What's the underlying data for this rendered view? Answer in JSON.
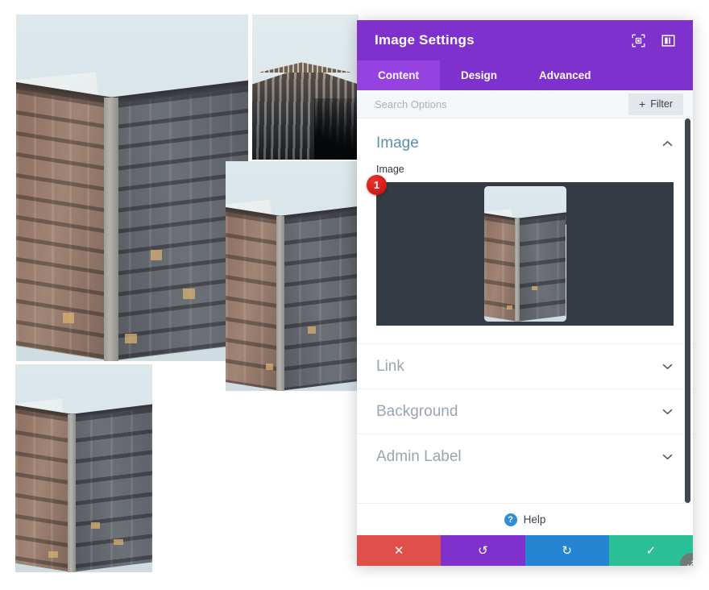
{
  "page": {
    "background_color": "#ffffff",
    "photos": [
      {
        "name": "photo-large-top-left",
        "alt": "Ornate stone building corner against pale sky"
      },
      {
        "name": "photo-tall-tower-top",
        "alt": "Modern tower photographed from below"
      },
      {
        "name": "photo-building-middle",
        "alt": "Stone building corner, vertical crop"
      },
      {
        "name": "photo-building-bottom-left",
        "alt": "Stone building corner, small vertical crop"
      }
    ]
  },
  "panel": {
    "title": "Image Settings",
    "header_color": "#7f31cd",
    "header_icons": [
      {
        "name": "fullscreen-icon",
        "label": "Fullscreen"
      },
      {
        "name": "layout-panel-icon",
        "label": "Change panel layout"
      }
    ],
    "tabs": [
      {
        "label": "Content",
        "active": true
      },
      {
        "label": "Design",
        "active": false
      },
      {
        "label": "Advanced",
        "active": false
      }
    ],
    "search": {
      "placeholder": "Search Options",
      "value": ""
    },
    "filter_button": {
      "label": "Filter",
      "plus": "+"
    },
    "sections": [
      {
        "title": "Image",
        "state": "open",
        "accent_color": "#5d8eb0",
        "fields": [
          {
            "label": "Image",
            "type": "image-upload",
            "badge": "1",
            "upload_background": "#343b45"
          }
        ]
      },
      {
        "title": "Link",
        "state": "closed"
      },
      {
        "title": "Background",
        "state": "closed"
      },
      {
        "title": "Admin Label",
        "state": "closed"
      }
    ],
    "help": {
      "label": "Help",
      "icon": "question-mark-icon",
      "icon_color": "#2d8fd5"
    },
    "actions": [
      {
        "name": "cancel",
        "glyph": "✕",
        "color": "#e04f4a"
      },
      {
        "name": "undo",
        "glyph": "↺",
        "color": "#7f31cd"
      },
      {
        "name": "redo",
        "glyph": "↻",
        "color": "#2585d3"
      },
      {
        "name": "save",
        "glyph": "✓",
        "color": "#2bbf96"
      }
    ],
    "resize_handle": {
      "name": "resize-handle",
      "icon": "diagonal-resize-icon"
    },
    "scrollbar": {
      "name": "panel-scrollbar",
      "color": "#3f4750"
    }
  }
}
